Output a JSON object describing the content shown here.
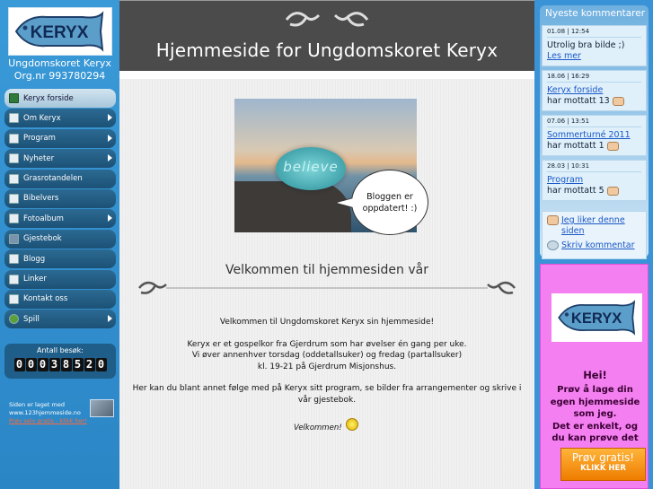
{
  "logo": {
    "text": "KERYX"
  },
  "org": {
    "name": "Ungdomskoret Keryx",
    "number": "Org.nr 993780294"
  },
  "menu": [
    {
      "label": "Keryx forside",
      "icon": "home-icon",
      "has_submenu": false,
      "active": true
    },
    {
      "label": "Om Keryx",
      "icon": "page-icon",
      "has_submenu": true
    },
    {
      "label": "Program",
      "icon": "page-icon",
      "has_submenu": true
    },
    {
      "label": "Nyheter",
      "icon": "page-icon",
      "has_submenu": true
    },
    {
      "label": "Grasrotandelen",
      "icon": "page-icon",
      "has_submenu": false
    },
    {
      "label": "Bibelvers",
      "icon": "page-icon",
      "has_submenu": false
    },
    {
      "label": "Fotoalbum",
      "icon": "page-icon",
      "has_submenu": true
    },
    {
      "label": "Gjestebok",
      "icon": "book-icon",
      "has_submenu": false
    },
    {
      "label": "Blogg",
      "icon": "page-icon",
      "has_submenu": false
    },
    {
      "label": "Linker",
      "icon": "page-icon",
      "has_submenu": false
    },
    {
      "label": "Kontakt oss",
      "icon": "page-icon",
      "has_submenu": false
    },
    {
      "label": "Spill",
      "icon": "game-icon",
      "has_submenu": true
    }
  ],
  "counter": {
    "label": "Antall besøk:",
    "digits": [
      "0",
      "0",
      "0",
      "3",
      "8",
      "5",
      "2",
      "0"
    ]
  },
  "made_with": {
    "line1": "Siden er laget med",
    "line2": "www.123hjemmeside.no",
    "line3": "Prøv selv gratis - klikk her!"
  },
  "header": {
    "title": "Hjemmeside for Ungdomskoret Keryx"
  },
  "banner": {
    "stone_text": "believe"
  },
  "bubble": {
    "text": "Bloggen er oppdatert! :)"
  },
  "welcome": {
    "heading": "Velkommen til hjemmesiden vår",
    "p1": "Velkommen til Ungdomskoret Keryx sin hjemmeside!",
    "p2": "Keryx er et gospelkor fra Gjerdrum som har øvelser én gang per uke.",
    "p3": "Vi øver annenhver torsdag (oddetallsuker) og fredag (partallsuker)",
    "p4": "kl. 19-21 på Gjerdrum Misjonshus.",
    "p5": "Her kan du blant annet følge med på Keryx sitt program, se bilder fra arrangementer og skrive i vår gjestebok.",
    "sign_off": "Velkommen!"
  },
  "comments": {
    "title": "Nyeste kommentarer",
    "items": [
      {
        "date": "01.08 | 12:54",
        "text": "Utrolig bra bilde ;) ",
        "link": "Les mer"
      },
      {
        "date": "18.06 | 16:29",
        "link": "Keryx forside",
        "text": "har mottatt 13"
      },
      {
        "date": "07.06 | 13:51",
        "link": "Sommerturné 2011",
        "text": "har mottatt 1"
      },
      {
        "date": "28.03 | 10:31",
        "link": "Program",
        "text": "har mottatt 5"
      }
    ],
    "like_label": "Jeg liker denne siden",
    "comment_label": "Skriv kommentar"
  },
  "promo": {
    "heading": "Hei!",
    "line1": "Prøv å lage din",
    "line2": "egen hjemmeside",
    "line3": "som jeg.",
    "line4": "Det er enkelt, og",
    "line5": "du kan prøve det",
    "button_line1": "Prøv gratis!",
    "button_line2": "KLIKK HER"
  },
  "colors": {
    "page_bg": "#2f8fcf",
    "header_bg": "#4b4b4b",
    "menu_bg": "#1c5176",
    "promo_bg": "#f47ff0",
    "promo_button": "#ee7d00"
  }
}
